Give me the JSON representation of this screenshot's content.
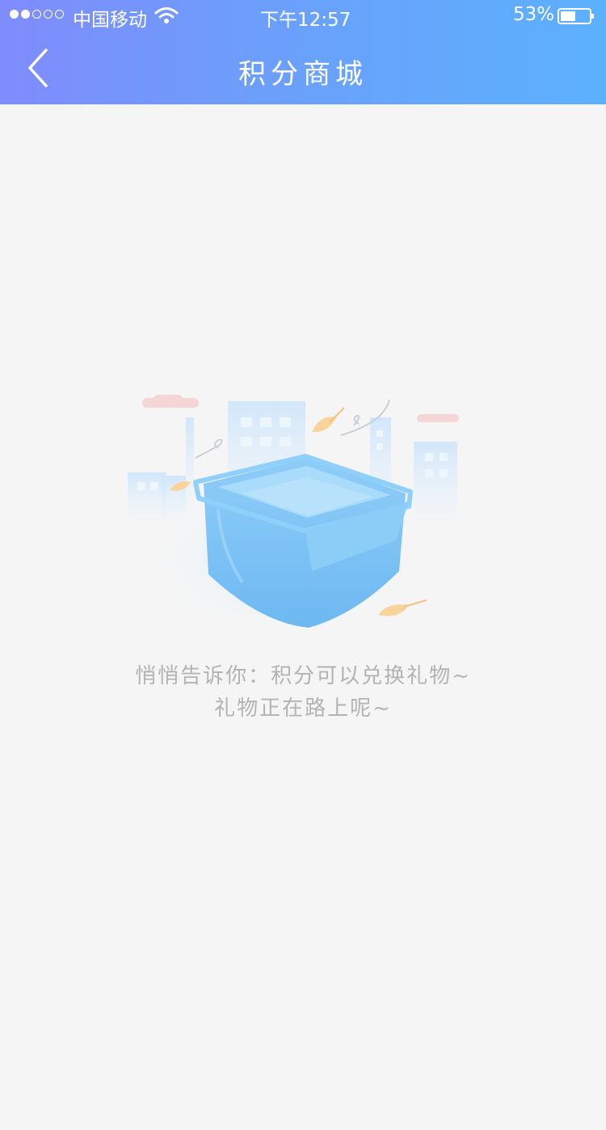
{
  "status_bar": {
    "carrier": "中国移动",
    "time": "下午12:57",
    "battery_percent": "53%",
    "battery_level": 0.53,
    "signal_strength": 2,
    "signal_max": 5
  },
  "nav": {
    "title": "积分商城",
    "back_icon": "chevron-left-icon"
  },
  "empty_state": {
    "illustration": "empty-box-illustration",
    "line1": "悄悄告诉你：积分可以兑换礼物~",
    "line2": "礼物正在路上呢~"
  },
  "colors": {
    "header_gradient_start": "#7f8cfc",
    "header_gradient_end": "#5cb1fd",
    "background": "#f5f5f5",
    "message_text": "#b3b3b3",
    "box_blue": "#7ec3f7"
  }
}
